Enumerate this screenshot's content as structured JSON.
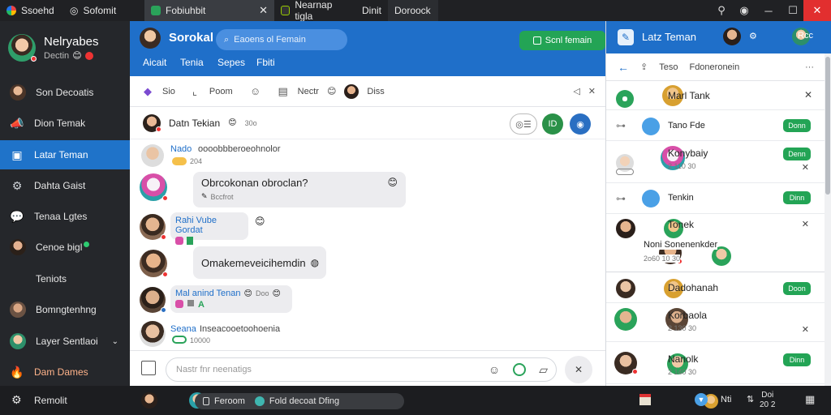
{
  "browser": {
    "tabs": [
      {
        "label": "Ssoehd",
        "icon": "app-icon",
        "active": false
      },
      {
        "label": "Sofomit",
        "icon": "globe-icon",
        "active": false
      },
      {
        "label": "Fobiuhbit",
        "icon": "chat-app-icon",
        "active": true
      },
      {
        "label": "Nearnap tigla",
        "icon": "terminal-icon",
        "active": false
      },
      {
        "label": "Dinit",
        "icon": "window-icon",
        "active": false
      },
      {
        "label": "Doroock",
        "icon": "tab-icon",
        "active": false
      }
    ]
  },
  "profile": {
    "name": "Nelryabes",
    "status": "Dectin"
  },
  "sidebar": {
    "items": [
      {
        "label": "Son Decoatis",
        "icon": "avatar",
        "active": false
      },
      {
        "label": "Dion Temak",
        "icon": "megaphone-icon",
        "active": false
      },
      {
        "label": "Latar Teman",
        "icon": "window-icon",
        "active": true
      },
      {
        "label": "Dahta Gaist",
        "icon": "gear-icon",
        "active": false
      },
      {
        "label": "Tenaa Lgtes",
        "icon": "chat-bubble-icon",
        "active": false
      },
      {
        "label": "Cenoe bigl",
        "icon": "avatar",
        "active": false
      },
      {
        "label": "Teniots",
        "icon": "",
        "active": false
      },
      {
        "label": "Bomngtenhng",
        "icon": "avatar",
        "active": false
      },
      {
        "label": "Layer Sentlaoi",
        "icon": "avatar",
        "active": false
      },
      {
        "label": "Dam Dames",
        "icon": "flame-icon",
        "active": false
      }
    ],
    "footer": {
      "label": "Remolit",
      "icon": "gear-icon"
    }
  },
  "center": {
    "title": "Sorokal",
    "search_placeholder": "Eaoens ol Femain",
    "action_button": "Scnl femain",
    "tabs": [
      "Aicait",
      "Tenia",
      "Sepes",
      "Fbiti"
    ],
    "toolbar": [
      {
        "label": "Sio",
        "icon": "brush-icon"
      },
      {
        "label": "Poom",
        "icon": "crop-icon"
      },
      {
        "label": "",
        "icon": "emoji-icon"
      },
      {
        "label": "Nectr",
        "icon": "card-icon"
      },
      {
        "label": "Diss",
        "icon": "avatar"
      }
    ],
    "thread": {
      "name": "Datn Tekian",
      "meta": "30o"
    },
    "messages": [
      {
        "sender": "Nado",
        "text": "oooobbberoeohnolor",
        "meta": "204"
      },
      {
        "sender": "",
        "text": "Obrcokonan obroclan?",
        "meta": "Bccfrot"
      },
      {
        "sender": "Rahi Vube Gordat",
        "text": "",
        "meta": ""
      },
      {
        "sender": "",
        "text": "Omakemeveicihemdin",
        "meta": ""
      },
      {
        "sender": "Mal anind Tenan",
        "text": "",
        "meta": "Doo"
      },
      {
        "sender": "Seana",
        "text": "Inseacooetoohoenia",
        "meta": "10000"
      }
    ],
    "composer_placeholder": "Nastr fnr neenatigs"
  },
  "right_panel": {
    "title": "Latz Teman",
    "header_right": "Rcc",
    "toolbar": [
      "Teso",
      "Fdoneronein"
    ],
    "rows": [
      {
        "name": "Marl Tank",
        "meta": "",
        "badge": ""
      },
      {
        "name": "Tano Fde",
        "meta": "",
        "badge": "Donn"
      },
      {
        "name": "Konybaiy",
        "meta": "2 110 30",
        "badge": "Denn"
      },
      {
        "name": "Tenkin",
        "meta": "",
        "badge": "Dinn"
      },
      {
        "name": "Tonek",
        "meta": "",
        "badge": ""
      },
      {
        "name": "Noni Sonenenkder",
        "meta": "2o60 10 30",
        "badge": ""
      },
      {
        "name": "Dadohanah",
        "meta": "",
        "badge": "Doon"
      },
      {
        "name": "Korbaola",
        "meta": "2 130 30",
        "badge": ""
      },
      {
        "name": "Nanolk",
        "meta": "2 140 30",
        "badge": "Dinn"
      }
    ]
  },
  "taskbar": {
    "search": "Feroom",
    "pill": "Fold decoat Dfing",
    "tray_label": "Nti",
    "clock": "Doi",
    "date": "20 2"
  },
  "colors": {
    "accent": "#1f6fc9",
    "green": "#23a455",
    "sidebar": "#25272b"
  }
}
